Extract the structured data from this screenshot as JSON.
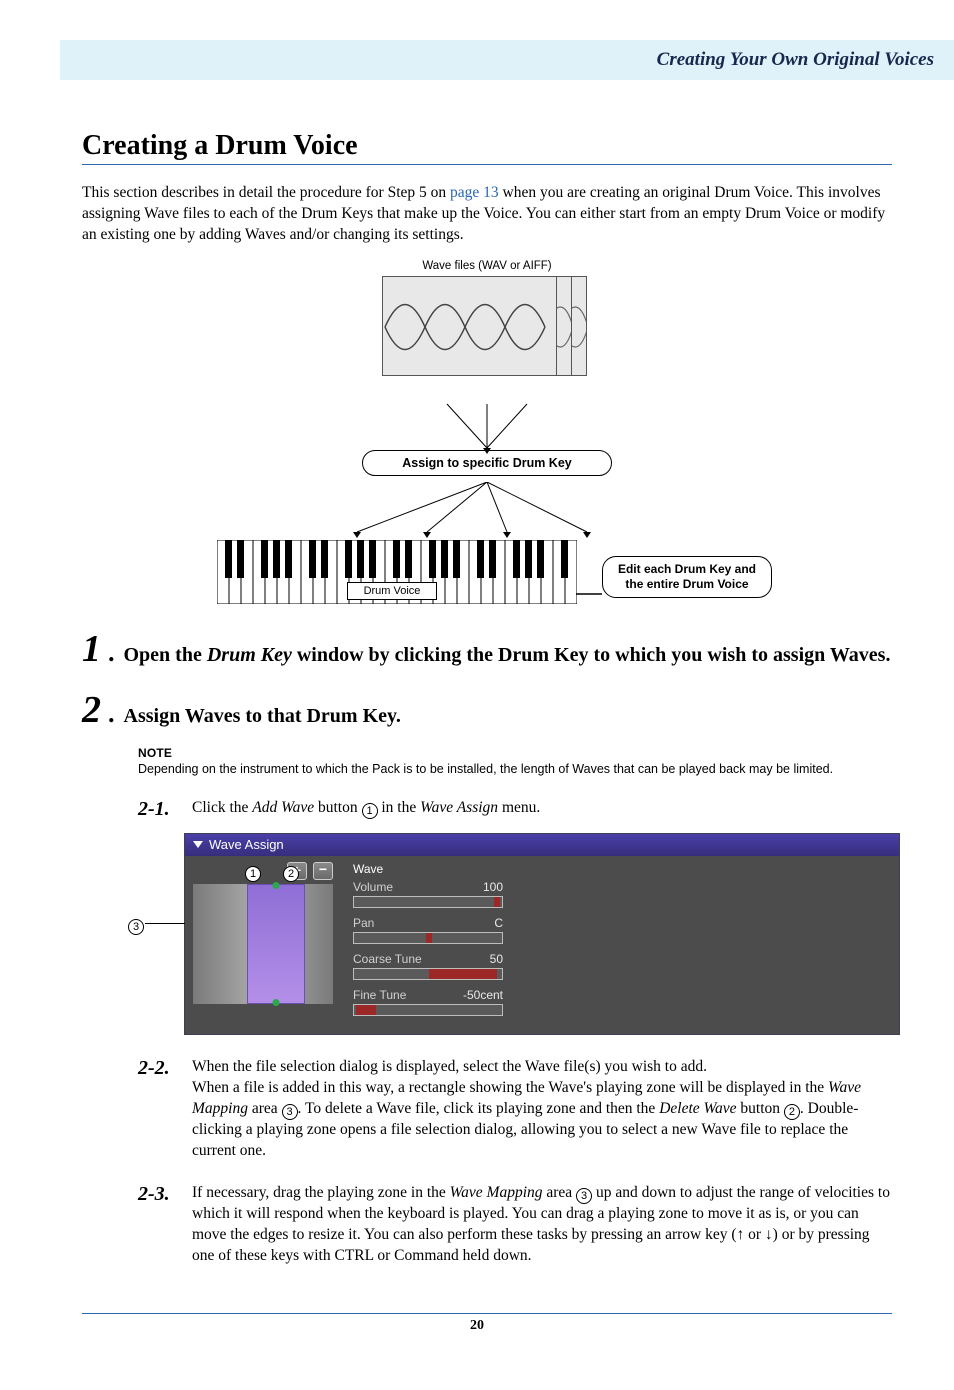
{
  "header": {
    "breadcrumb": "Creating Your Own Original Voices"
  },
  "title": "Creating a Drum Voice",
  "intro": {
    "pre": "This section describes in detail the procedure for Step 5 on ",
    "link": "page 13",
    "post": " when you are creating an original Drum Voice. This involves assigning Wave files to each of the Drum Keys that make up the Voice. You can either start from an empty Drum Voice or modify an existing one by adding Waves and/or changing its settings."
  },
  "diagram": {
    "wave_caption": "Wave files (WAV or AIFF)",
    "assign_label": "Assign to specific Drum Key",
    "drum_voice_label": "Drum Voice",
    "edit_label_l1": "Edit each Drum Key and",
    "edit_label_l2": "the entire Drum Voice"
  },
  "step1": {
    "num": "1",
    "dot": ".",
    "title_pre": "Open the ",
    "title_em": "Drum Key",
    "title_post": " window by clicking the Drum Key to which you wish to assign Waves."
  },
  "step2": {
    "num": "2",
    "dot": ".",
    "title": "Assign Waves to that Drum Key."
  },
  "note": {
    "label": "NOTE",
    "text": "Depending on the instrument to which the Pack is to be installed, the length of Waves that can be played back may be limited."
  },
  "sub21": {
    "num": "2-1.",
    "pre": "Click the ",
    "em1": "Add Wave",
    "mid": " button ",
    "c1": "1",
    "mid2": " in the ",
    "em2": "Wave Assign",
    "post": " menu."
  },
  "wa": {
    "left_c3": "3",
    "overlay_c1": "1",
    "overlay_c2": "2",
    "title": "Wave Assign",
    "params": {
      "wave": "Wave",
      "volume_label": "Volume",
      "volume_val": "100",
      "pan_label": "Pan",
      "pan_val": "C",
      "coarse_label": "Coarse Tune",
      "coarse_val": "50",
      "fine_label": "Fine Tune",
      "fine_val": "-50cent"
    }
  },
  "sub22": {
    "num": "2-2.",
    "line1": "When the file selection dialog is displayed, select the Wave file(s) you wish to add.",
    "l2a": "When a file is added in this way, a rectangle showing the Wave's playing zone will be displayed in the ",
    "l2em1": "Wave Mapping",
    "l2b": " area ",
    "l2c3": "3",
    "l2c": ". To delete a Wave file, click its playing zone and then the ",
    "l2em2": "Delete Wave",
    "l2d": " button ",
    "l2c2": "2",
    "l2e": ". Double-clicking a playing zone opens a file selection dialog, allowing you to select a new Wave file to replace the current one."
  },
  "sub23": {
    "num": "2-3.",
    "a": "If necessary, drag the playing zone in the ",
    "em": "Wave Mapping",
    "b": " area ",
    "c3": "3",
    "c": " up and down to adjust the range of velocities to which it will respond when the keyboard is played. You can drag a playing zone to move it as is, or you can move the edges to resize it. You can also perform these tasks by pressing an arrow key (↑ or ↓) or by pressing one of these keys with CTRL or Command held down."
  },
  "page_number": "20"
}
